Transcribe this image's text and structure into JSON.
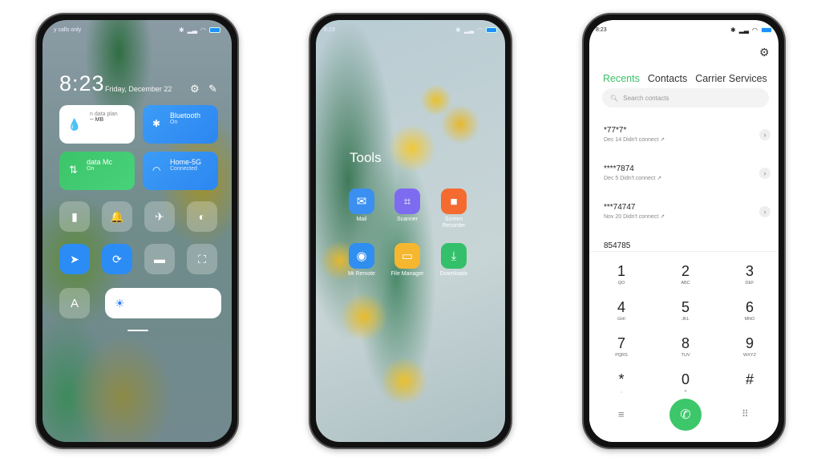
{
  "control_center": {
    "status": {
      "left": "y calls only"
    },
    "time": "8:23",
    "date": "Friday, December 22",
    "tiles": [
      {
        "title": "n data plan",
        "sub": "-- MB"
      },
      {
        "title": "Bluetooth",
        "sub": "On"
      },
      {
        "title": "data   Mc",
        "sub": "On"
      },
      {
        "title": "Home-5G",
        "sub": "Connected"
      }
    ],
    "toggles": [
      "flashlight",
      "bell",
      "airplane",
      "dark-mode",
      "location",
      "rotation-lock",
      "video",
      "scan"
    ],
    "font_label": "A"
  },
  "home": {
    "status": {
      "time": "8:23"
    },
    "folder": "Tools",
    "apps": [
      {
        "label": "Mail",
        "color": "#3a8ff0",
        "icon": "✉"
      },
      {
        "label": "Scanner",
        "color": "#7d6cf0",
        "icon": "⌗"
      },
      {
        "label": "Screen Recorder",
        "color": "#f56a2f",
        "icon": "■"
      },
      {
        "label": "Mi Remote",
        "color": "#2f8ef0",
        "icon": "◉"
      },
      {
        "label": "File Manager",
        "color": "#f5b630",
        "icon": "▭"
      },
      {
        "label": "Downloads",
        "color": "#34c06a",
        "icon": "⤓"
      }
    ]
  },
  "dialer": {
    "status": {
      "time": "8:23"
    },
    "tabs": [
      "Recents",
      "Contacts",
      "Carrier Services"
    ],
    "search_placeholder": "Search contacts",
    "recents": [
      {
        "number": "*77*7*",
        "detail": "Dec 14 Didn't connect ↗"
      },
      {
        "number": "****7874",
        "detail": "Dec 5 Didn't connect ↗"
      },
      {
        "number": "***74747",
        "detail": "Nov 20 Didn't connect ↗"
      },
      {
        "number": "854785",
        "detail": ""
      }
    ],
    "keys": [
      {
        "d": "1",
        "l": "QO"
      },
      {
        "d": "2",
        "l": "ABC"
      },
      {
        "d": "3",
        "l": "DEF"
      },
      {
        "d": "4",
        "l": "GHI"
      },
      {
        "d": "5",
        "l": "JKL"
      },
      {
        "d": "6",
        "l": "MNO"
      },
      {
        "d": "7",
        "l": "PQRS"
      },
      {
        "d": "8",
        "l": "TUV"
      },
      {
        "d": "9",
        "l": "WXYZ"
      },
      {
        "d": "*",
        "l": ","
      },
      {
        "d": "0",
        "l": "+"
      },
      {
        "d": "#",
        "l": ""
      }
    ]
  }
}
